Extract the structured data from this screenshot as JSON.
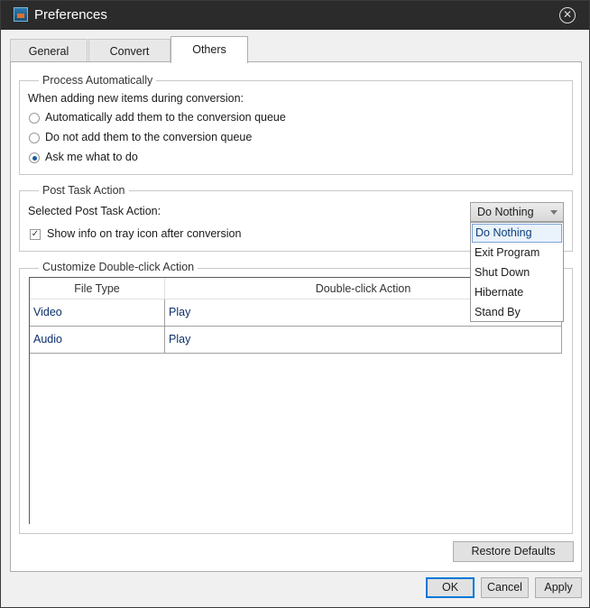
{
  "window": {
    "title": "Preferences"
  },
  "tabs": [
    {
      "label": "General"
    },
    {
      "label": "Convert"
    },
    {
      "label": "Others"
    }
  ],
  "process_automatically": {
    "legend": "Process Automatically",
    "prompt": "When adding new items during conversion:",
    "options": [
      {
        "label": "Automatically add them to the conversion queue",
        "selected": false
      },
      {
        "label": "Do not add them to the conversion queue",
        "selected": false
      },
      {
        "label": "Ask me what to do",
        "selected": true
      }
    ]
  },
  "post_task": {
    "legend": "Post Task Action",
    "label": "Selected Post Task Action:",
    "selected": "Do Nothing",
    "options": [
      "Do Nothing",
      "Exit Program",
      "Shut Down",
      "Hibernate",
      "Stand By"
    ],
    "tray_checkbox_label": "Show info on tray icon after conversion",
    "tray_checked": true
  },
  "double_click": {
    "legend": "Customize Double-click Action",
    "columns": [
      "File Type",
      "Double-click Action"
    ],
    "rows": [
      {
        "type": "Video",
        "action": "Play"
      },
      {
        "type": "Audio",
        "action": "Play"
      }
    ]
  },
  "buttons": {
    "restore": "Restore Defaults",
    "ok": "OK",
    "cancel": "Cancel",
    "apply": "Apply"
  },
  "colors": {
    "titlebar": "#2b2b2b",
    "selection": "#eaf2fb",
    "link_text": "#0b2f6b"
  }
}
